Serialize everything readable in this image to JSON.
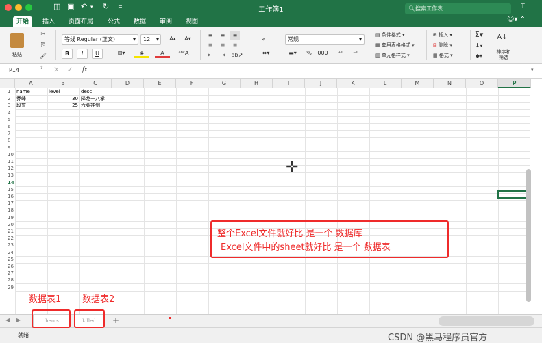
{
  "titlebar": {
    "title": "工作簿1",
    "search_placeholder": "搜索工作表",
    "share_icon": "person-plus-icon",
    "home_icon": "sidebar-icon",
    "save_icon": "save-icon",
    "undo_icon": "undo-icon",
    "redo_icon": "redo-icon",
    "more_icon": "dropdown-arrow-icon",
    "smiley_icon": "smiley-icon"
  },
  "tabs": [
    "开始",
    "插入",
    "页面布局",
    "公式",
    "数据",
    "审阅",
    "视图"
  ],
  "ribbon": {
    "paste_label": "粘贴",
    "font_name": "等线 Regular (正文)",
    "font_size": "12",
    "bold": "B",
    "italic": "I",
    "underline": "U",
    "number_format": "常规",
    "percent": "%",
    "thousand": "000",
    "cond_format": "条件格式",
    "table_format": "套用表格格式",
    "cell_style": "单元格样式",
    "insert": "插入",
    "delete": "删除",
    "format": "格式",
    "sort_filter": "排序和筛选",
    "colors": {
      "accent": "#217346",
      "font_underline": "#e03b3b",
      "fill_underline": "#f5e400"
    }
  },
  "formula": {
    "cell_ref": "P14",
    "fx": "fx",
    "value": ""
  },
  "grid": {
    "columns": [
      "A",
      "B",
      "C",
      "D",
      "E",
      "F",
      "G",
      "H",
      "I",
      "J",
      "K",
      "L",
      "M",
      "N",
      "O",
      "P"
    ],
    "selected_column": "P",
    "selected_row": "14",
    "row_count": 28,
    "cells": [
      {
        "r": 1,
        "c": "A",
        "v": "name",
        "align": "left"
      },
      {
        "r": 1,
        "c": "B",
        "v": "level",
        "align": "left"
      },
      {
        "r": 1,
        "c": "C",
        "v": "desc",
        "align": "left"
      },
      {
        "r": 2,
        "c": "A",
        "v": "乔峰",
        "align": "left"
      },
      {
        "r": 2,
        "c": "B",
        "v": "30",
        "align": "right"
      },
      {
        "r": 2,
        "c": "C",
        "v": "降龙十八掌",
        "align": "left"
      },
      {
        "r": 3,
        "c": "A",
        "v": "段誉",
        "align": "left"
      },
      {
        "r": 3,
        "c": "B",
        "v": "25",
        "align": "right"
      },
      {
        "r": 3,
        "c": "C",
        "v": "六脉神剑",
        "align": "left"
      }
    ]
  },
  "sheets": [
    "heros",
    "killed"
  ],
  "add_sheet": "+",
  "status": {
    "ready": "就绪"
  },
  "annotations": {
    "line1": "整个Excel文件就好比 是一个 数据库",
    "line2": "Excel文件中的sheet就好比 是一个 数据表",
    "label1": "数据表1",
    "label2": "数据表2",
    "color": "#ef2b2b"
  },
  "watermark": "CSDN @黑马程序员官方"
}
